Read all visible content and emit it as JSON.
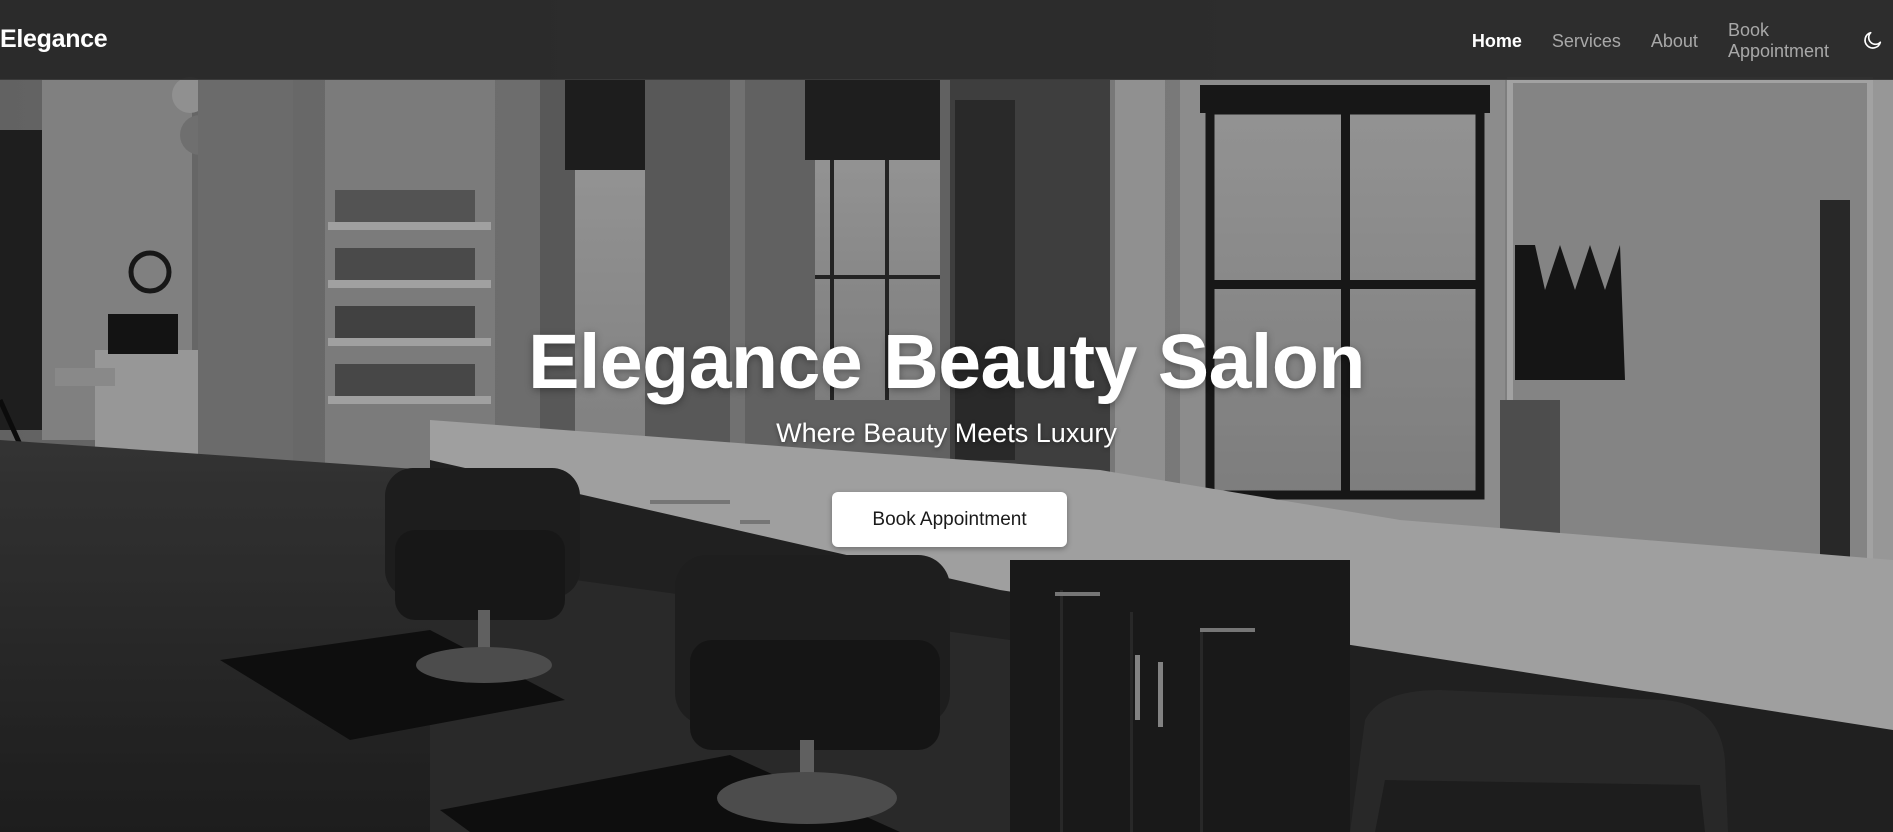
{
  "brand": {
    "name": "Elegance"
  },
  "nav": {
    "links": [
      {
        "label": "Home",
        "active": true
      },
      {
        "label": "Services",
        "active": false
      },
      {
        "label": "About",
        "active": false
      },
      {
        "label": "Book Appointment",
        "active": false
      }
    ],
    "theme_toggle_icon": "moon-icon"
  },
  "hero": {
    "title": "Elegance Beauty Salon",
    "subtitle": "Where Beauty Meets Luxury",
    "cta_label": "Book Appointment",
    "background_image": "salon-interior-grayscale"
  },
  "colors": {
    "nav_background": "#262626",
    "nav_active": "#ffffff",
    "nav_inactive": "#a8a8a8",
    "cta_background": "#ffffff",
    "cta_text": "#1a1a1a"
  }
}
